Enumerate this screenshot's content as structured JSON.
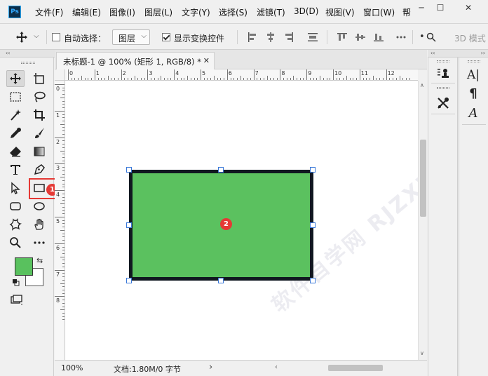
{
  "app": {
    "logo_text": "Ps"
  },
  "menu": [
    "文件(F)",
    "编辑(E)",
    "图像(I)",
    "图层(L)",
    "文字(Y)",
    "选择(S)",
    "滤镜(T)",
    "3D(D)",
    "视图(V)",
    "窗口(W)",
    "帮"
  ],
  "window_controls": {
    "minimize": "─",
    "maximize": "☐",
    "close": "✕"
  },
  "options_bar": {
    "auto_select_label": "自动选择：",
    "auto_select_checked": false,
    "layer_select_value": "图层",
    "show_transform_label": "显示变换控件",
    "show_transform_checked": true,
    "mode_3d_label": "3D 模式"
  },
  "document": {
    "tab_title": "未标题-1 @ 100% (矩形 1, RGB/8) *",
    "tab_close": "✕",
    "zoom": "100%",
    "doc_info": "文档:1.80M/0 字节",
    "status_arrow": "›"
  },
  "rulers": {
    "top": [
      "0",
      "1",
      "2",
      "3",
      "4",
      "5",
      "6",
      "7",
      "8",
      "9",
      "10",
      "11",
      "12"
    ],
    "left": [
      "0",
      "1",
      "2",
      "3",
      "4",
      "5",
      "6",
      "7",
      "8"
    ]
  },
  "shape": {
    "fill_color": "#5bc15f",
    "stroke_color": "#111820"
  },
  "colors": {
    "foreground": "#59c15e",
    "background": "#ffffff",
    "accent": "#e53935"
  },
  "annotations": {
    "badge_1": "1",
    "badge_2": "2"
  },
  "watermark": "软件自学网 RJZXW.COM",
  "panel_icons": {
    "left_column": [
      "stamp-history-icon",
      "tools-wrench-icon"
    ],
    "right_column": [
      "character-icon",
      "paragraph-icon",
      "glyph-icon"
    ]
  },
  "panel_text": {
    "character": "A|",
    "paragraph": "¶",
    "glyph": "A"
  }
}
